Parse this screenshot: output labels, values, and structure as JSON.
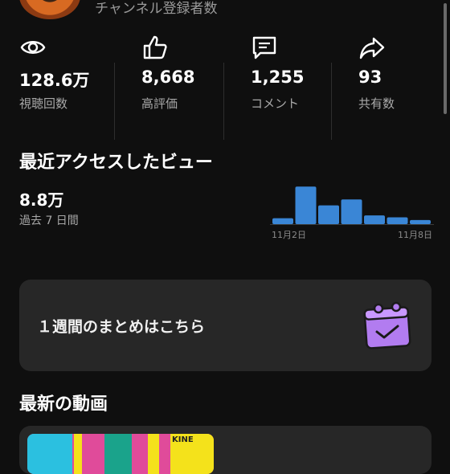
{
  "channel": {
    "subscriber_label": "チャンネル登録者数"
  },
  "stats": [
    {
      "icon": "eye-icon",
      "value": "128.6万",
      "label": "視聴回数"
    },
    {
      "icon": "thumbs-up-icon",
      "value": "8,668",
      "label": "高評価"
    },
    {
      "icon": "comment-icon",
      "value": "1,255",
      "label": "コメント"
    },
    {
      "icon": "share-icon",
      "value": "93",
      "label": "共有数"
    }
  ],
  "recent": {
    "title": "最近アクセスしたビュー",
    "value": "8.8万",
    "period": "過去 7 日間"
  },
  "chart_data": {
    "type": "bar",
    "categories": [
      "11月2日",
      "",
      "",
      "",
      "",
      "11月8日"
    ],
    "values": [
      0.13,
      0.82,
      0.41,
      0.54,
      0.19,
      0.15,
      0.09
    ],
    "x_tick_labels": [
      "11月2日",
      "11月8日"
    ],
    "title": "",
    "xlabel": "",
    "ylabel": "",
    "color": "#3a86d6",
    "grid": false
  },
  "summary": {
    "label": "１週間のまとめはこちら",
    "icon": "calendar-check-icon"
  },
  "latest": {
    "title": "最新の動画",
    "thumb_tag": "KINE"
  },
  "colors": {
    "background": "#0f0f0f",
    "card": "#272727",
    "accent": "#b27cf0",
    "bar": "#3a86d6"
  }
}
